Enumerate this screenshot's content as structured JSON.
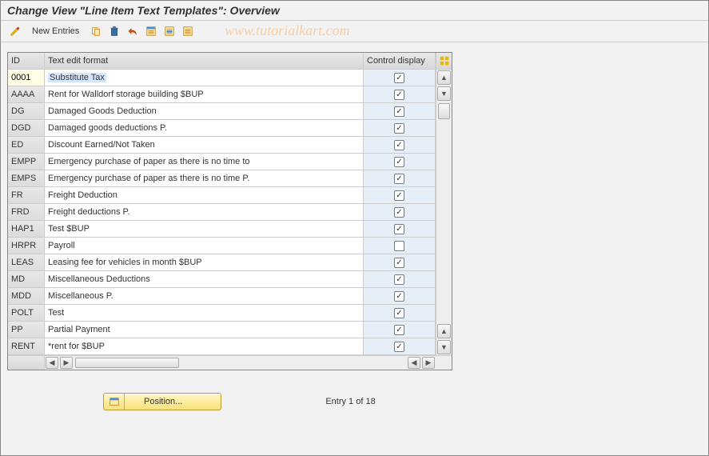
{
  "title": "Change View \"Line Item Text Templates\": Overview",
  "watermark": "www.tutorialkart.com",
  "toolbar": {
    "new_entries_label": "New Entries",
    "icons": {
      "toggle": "toggle",
      "check": "check",
      "new_entries": "new_entries",
      "copy": "copy",
      "delete": "delete",
      "undo": "undo",
      "select_all": "select_all",
      "select_block": "select_block",
      "deselect_all": "deselect_all"
    }
  },
  "table": {
    "headers": {
      "id": "ID",
      "text": "Text edit format",
      "control": "Control display"
    },
    "rows": [
      {
        "id": "0001",
        "text": "Substitute Tax",
        "control": true,
        "editable_id": true,
        "selected_text": true
      },
      {
        "id": "AAAA",
        "text": "Rent for Walldorf storage building $BUP",
        "control": true
      },
      {
        "id": "DG",
        "text": "Damaged Goods Deduction",
        "control": true
      },
      {
        "id": "DGD",
        "text": "Damaged goods deductions P.",
        "control": true
      },
      {
        "id": "ED",
        "text": "Discount Earned/Not Taken",
        "control": true
      },
      {
        "id": "EMPP",
        "text": "Emergency purchase of paper as there is no time to",
        "control": true
      },
      {
        "id": "EMPS",
        "text": "Emergency purchase of paper as there is no time P.",
        "control": true
      },
      {
        "id": "FR",
        "text": "Freight Deduction",
        "control": true
      },
      {
        "id": "FRD",
        "text": "Freight deductions P.",
        "control": true
      },
      {
        "id": "HAP1",
        "text": "Test $BUP",
        "control": true
      },
      {
        "id": "HRPR",
        "text": "Payroll",
        "control": false
      },
      {
        "id": "LEAS",
        "text": "Leasing fee for vehicles in month $BUP",
        "control": true
      },
      {
        "id": "MD",
        "text": "Miscellaneous Deductions",
        "control": true
      },
      {
        "id": "MDD",
        "text": "Miscellaneous P.",
        "control": true
      },
      {
        "id": "POLT",
        "text": "Test",
        "control": true
      },
      {
        "id": "PP",
        "text": "Partial Payment",
        "control": true
      },
      {
        "id": "RENT",
        "text": "*rent for $BUP",
        "control": true
      }
    ]
  },
  "footer": {
    "position_label": "Position...",
    "entry_text": "Entry 1 of 18"
  }
}
